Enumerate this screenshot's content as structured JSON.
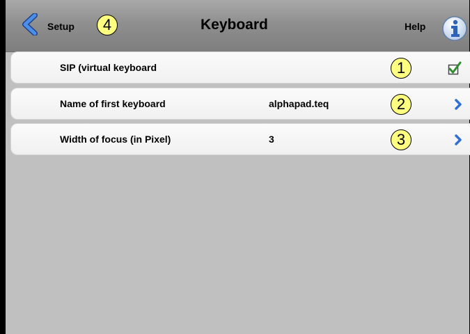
{
  "header": {
    "back_label": "Setup",
    "back_badge": "4",
    "title": "Keyboard",
    "help_label": "Help"
  },
  "rows": [
    {
      "label": "SIP (virtual keyboard",
      "value": "",
      "badge": "1",
      "accessory": "checkmark-icon",
      "checked": true
    },
    {
      "label": "Name of first keyboard",
      "value": "alphapad.teq",
      "badge": "2",
      "accessory": "chevron-right-icon"
    },
    {
      "label": "Width of focus (in Pixel)",
      "value": "3",
      "badge": "3",
      "accessory": "chevron-right-icon"
    }
  ],
  "colors": {
    "badge_fill": "#ffff80",
    "accent_blue": "#2f6fd6",
    "check_green": "#2f8f2f",
    "background": "#c0c0c0"
  }
}
